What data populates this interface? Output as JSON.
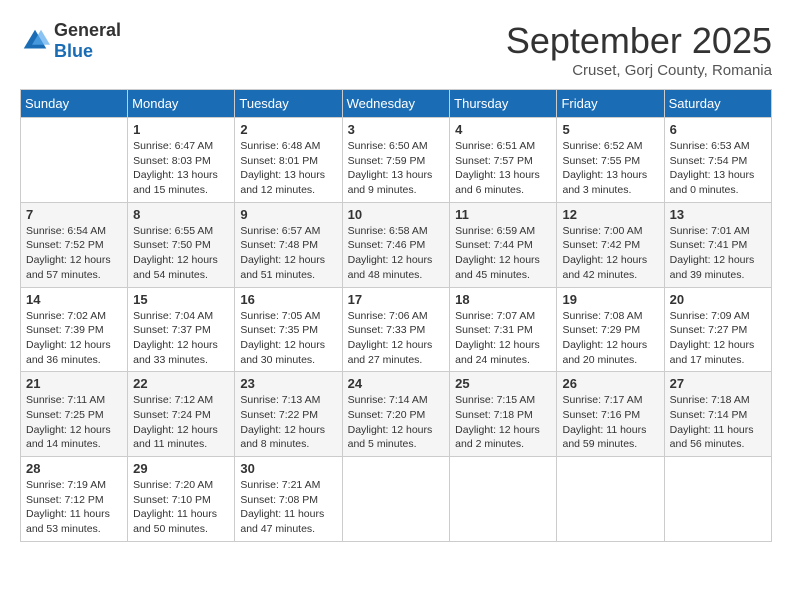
{
  "header": {
    "logo_general": "General",
    "logo_blue": "Blue",
    "month_title": "September 2025",
    "subtitle": "Cruset, Gorj County, Romania"
  },
  "days_of_week": [
    "Sunday",
    "Monday",
    "Tuesday",
    "Wednesday",
    "Thursday",
    "Friday",
    "Saturday"
  ],
  "weeks": [
    [
      {
        "day": "",
        "sunrise": "",
        "sunset": "",
        "daylight": ""
      },
      {
        "day": "1",
        "sunrise": "Sunrise: 6:47 AM",
        "sunset": "Sunset: 8:03 PM",
        "daylight": "Daylight: 13 hours and 15 minutes."
      },
      {
        "day": "2",
        "sunrise": "Sunrise: 6:48 AM",
        "sunset": "Sunset: 8:01 PM",
        "daylight": "Daylight: 13 hours and 12 minutes."
      },
      {
        "day": "3",
        "sunrise": "Sunrise: 6:50 AM",
        "sunset": "Sunset: 7:59 PM",
        "daylight": "Daylight: 13 hours and 9 minutes."
      },
      {
        "day": "4",
        "sunrise": "Sunrise: 6:51 AM",
        "sunset": "Sunset: 7:57 PM",
        "daylight": "Daylight: 13 hours and 6 minutes."
      },
      {
        "day": "5",
        "sunrise": "Sunrise: 6:52 AM",
        "sunset": "Sunset: 7:55 PM",
        "daylight": "Daylight: 13 hours and 3 minutes."
      },
      {
        "day": "6",
        "sunrise": "Sunrise: 6:53 AM",
        "sunset": "Sunset: 7:54 PM",
        "daylight": "Daylight: 13 hours and 0 minutes."
      }
    ],
    [
      {
        "day": "7",
        "sunrise": "Sunrise: 6:54 AM",
        "sunset": "Sunset: 7:52 PM",
        "daylight": "Daylight: 12 hours and 57 minutes."
      },
      {
        "day": "8",
        "sunrise": "Sunrise: 6:55 AM",
        "sunset": "Sunset: 7:50 PM",
        "daylight": "Daylight: 12 hours and 54 minutes."
      },
      {
        "day": "9",
        "sunrise": "Sunrise: 6:57 AM",
        "sunset": "Sunset: 7:48 PM",
        "daylight": "Daylight: 12 hours and 51 minutes."
      },
      {
        "day": "10",
        "sunrise": "Sunrise: 6:58 AM",
        "sunset": "Sunset: 7:46 PM",
        "daylight": "Daylight: 12 hours and 48 minutes."
      },
      {
        "day": "11",
        "sunrise": "Sunrise: 6:59 AM",
        "sunset": "Sunset: 7:44 PM",
        "daylight": "Daylight: 12 hours and 45 minutes."
      },
      {
        "day": "12",
        "sunrise": "Sunrise: 7:00 AM",
        "sunset": "Sunset: 7:42 PM",
        "daylight": "Daylight: 12 hours and 42 minutes."
      },
      {
        "day": "13",
        "sunrise": "Sunrise: 7:01 AM",
        "sunset": "Sunset: 7:41 PM",
        "daylight": "Daylight: 12 hours and 39 minutes."
      }
    ],
    [
      {
        "day": "14",
        "sunrise": "Sunrise: 7:02 AM",
        "sunset": "Sunset: 7:39 PM",
        "daylight": "Daylight: 12 hours and 36 minutes."
      },
      {
        "day": "15",
        "sunrise": "Sunrise: 7:04 AM",
        "sunset": "Sunset: 7:37 PM",
        "daylight": "Daylight: 12 hours and 33 minutes."
      },
      {
        "day": "16",
        "sunrise": "Sunrise: 7:05 AM",
        "sunset": "Sunset: 7:35 PM",
        "daylight": "Daylight: 12 hours and 30 minutes."
      },
      {
        "day": "17",
        "sunrise": "Sunrise: 7:06 AM",
        "sunset": "Sunset: 7:33 PM",
        "daylight": "Daylight: 12 hours and 27 minutes."
      },
      {
        "day": "18",
        "sunrise": "Sunrise: 7:07 AM",
        "sunset": "Sunset: 7:31 PM",
        "daylight": "Daylight: 12 hours and 24 minutes."
      },
      {
        "day": "19",
        "sunrise": "Sunrise: 7:08 AM",
        "sunset": "Sunset: 7:29 PM",
        "daylight": "Daylight: 12 hours and 20 minutes."
      },
      {
        "day": "20",
        "sunrise": "Sunrise: 7:09 AM",
        "sunset": "Sunset: 7:27 PM",
        "daylight": "Daylight: 12 hours and 17 minutes."
      }
    ],
    [
      {
        "day": "21",
        "sunrise": "Sunrise: 7:11 AM",
        "sunset": "Sunset: 7:25 PM",
        "daylight": "Daylight: 12 hours and 14 minutes."
      },
      {
        "day": "22",
        "sunrise": "Sunrise: 7:12 AM",
        "sunset": "Sunset: 7:24 PM",
        "daylight": "Daylight: 12 hours and 11 minutes."
      },
      {
        "day": "23",
        "sunrise": "Sunrise: 7:13 AM",
        "sunset": "Sunset: 7:22 PM",
        "daylight": "Daylight: 12 hours and 8 minutes."
      },
      {
        "day": "24",
        "sunrise": "Sunrise: 7:14 AM",
        "sunset": "Sunset: 7:20 PM",
        "daylight": "Daylight: 12 hours and 5 minutes."
      },
      {
        "day": "25",
        "sunrise": "Sunrise: 7:15 AM",
        "sunset": "Sunset: 7:18 PM",
        "daylight": "Daylight: 12 hours and 2 minutes."
      },
      {
        "day": "26",
        "sunrise": "Sunrise: 7:17 AM",
        "sunset": "Sunset: 7:16 PM",
        "daylight": "Daylight: 11 hours and 59 minutes."
      },
      {
        "day": "27",
        "sunrise": "Sunrise: 7:18 AM",
        "sunset": "Sunset: 7:14 PM",
        "daylight": "Daylight: 11 hours and 56 minutes."
      }
    ],
    [
      {
        "day": "28",
        "sunrise": "Sunrise: 7:19 AM",
        "sunset": "Sunset: 7:12 PM",
        "daylight": "Daylight: 11 hours and 53 minutes."
      },
      {
        "day": "29",
        "sunrise": "Sunrise: 7:20 AM",
        "sunset": "Sunset: 7:10 PM",
        "daylight": "Daylight: 11 hours and 50 minutes."
      },
      {
        "day": "30",
        "sunrise": "Sunrise: 7:21 AM",
        "sunset": "Sunset: 7:08 PM",
        "daylight": "Daylight: 11 hours and 47 minutes."
      },
      {
        "day": "",
        "sunrise": "",
        "sunset": "",
        "daylight": ""
      },
      {
        "day": "",
        "sunrise": "",
        "sunset": "",
        "daylight": ""
      },
      {
        "day": "",
        "sunrise": "",
        "sunset": "",
        "daylight": ""
      },
      {
        "day": "",
        "sunrise": "",
        "sunset": "",
        "daylight": ""
      }
    ]
  ]
}
